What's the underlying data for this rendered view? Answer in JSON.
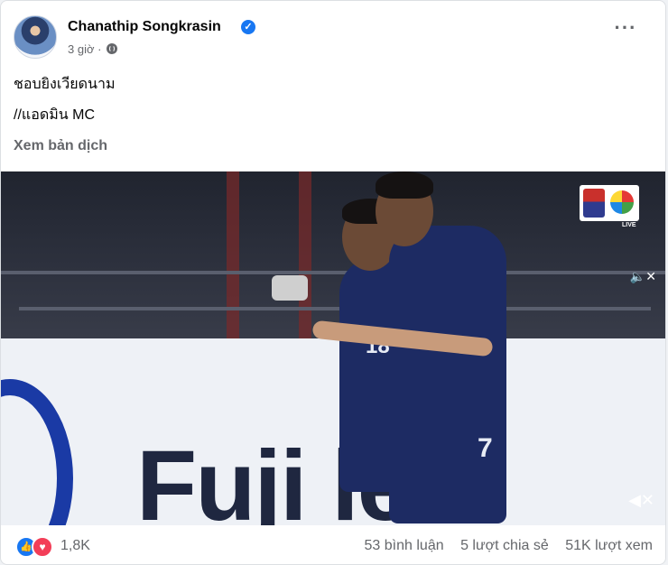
{
  "post": {
    "author": "Chanathip Songkrasin",
    "time": "3 giờ",
    "separator": "·",
    "line1": "ชอบยิงเวียดนาม",
    "line2": "//แอดมิน MC",
    "translate": "Xem bản dịch"
  },
  "video": {
    "board_text": "Fuji leo",
    "jersey_left": "18",
    "jersey_right": "7",
    "badge_live": "LIVE"
  },
  "footer": {
    "reactions": "1,8K",
    "comments": "53 bình luận",
    "shares": "5 lượt chia sẻ",
    "views": "51K lượt xem"
  },
  "icons": [
    "verified-badge-icon",
    "globe-icon",
    "more-options-icon",
    "like-reaction-icon",
    "love-reaction-icon",
    "volume-icon"
  ],
  "colors": {
    "accent": "#1877f2",
    "love": "#f33e58",
    "text_secondary": "#65676b"
  }
}
